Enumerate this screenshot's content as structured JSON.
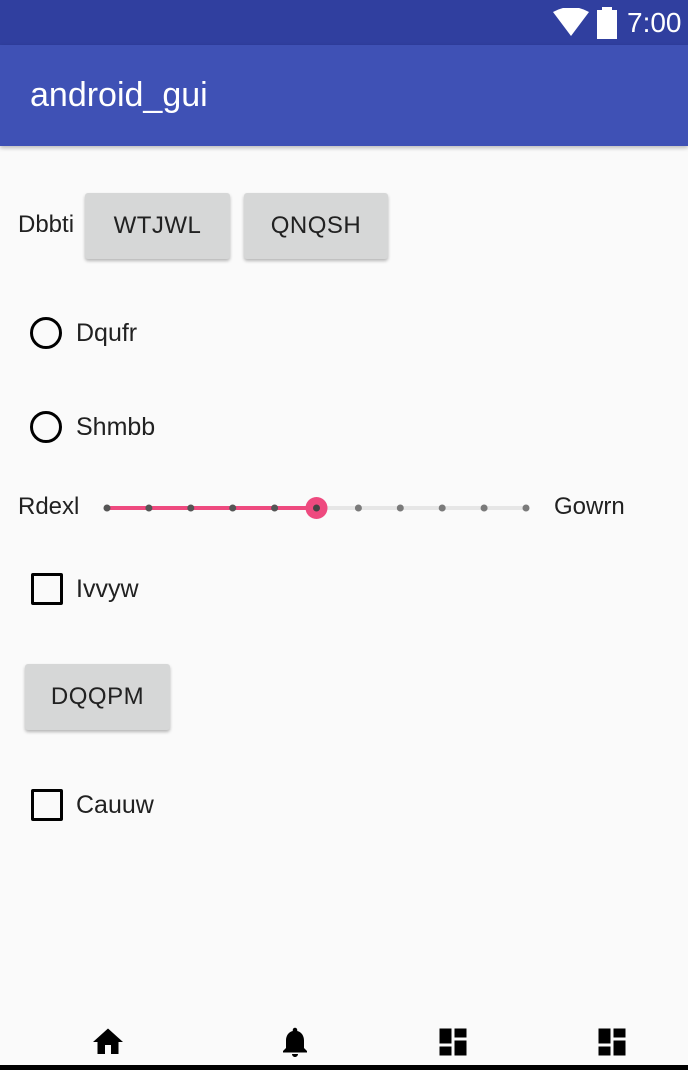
{
  "status_bar": {
    "time": "7:00",
    "icons": [
      "wifi-icon",
      "battery-icon"
    ]
  },
  "app_bar": {
    "title": "android_gui"
  },
  "row1": {
    "label": "Dbbti",
    "button1": "WTJWL",
    "button2": "QNQSH"
  },
  "radios": [
    {
      "label": "Dqufr",
      "checked": false
    },
    {
      "label": "Shmbb",
      "checked": false
    }
  ],
  "slider": {
    "min_label": "Rdexl",
    "max_label": "Gowrn",
    "steps": 10,
    "value": 5,
    "accent": "#ee4a7f"
  },
  "checkbox1": {
    "label": "Ivvyw",
    "checked": false
  },
  "button3": {
    "label": "DQQPM"
  },
  "checkbox2": {
    "label": "Cauuw",
    "checked": false
  },
  "bottom_nav": {
    "icons": [
      "home-icon",
      "bell-icon",
      "dashboard-icon",
      "dashboard-icon"
    ]
  },
  "colors": {
    "status_bar": "#303f9f",
    "app_bar": "#3f51b5",
    "background": "#fafafa",
    "button": "#d6d7d7"
  }
}
